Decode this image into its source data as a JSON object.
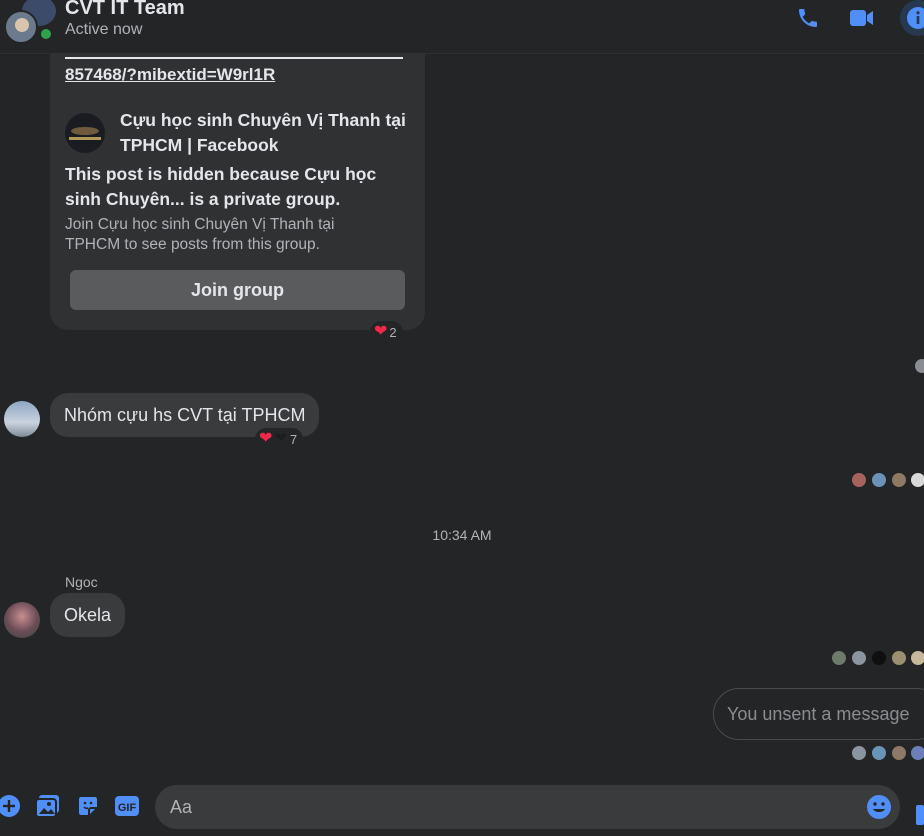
{
  "header": {
    "title": "CVT IT Team",
    "status": "Active now",
    "icons": [
      "phone-icon",
      "video-camera-icon",
      "info-icon"
    ]
  },
  "shared_post": {
    "link_text": "857468/?mibextid=W9rl1R",
    "group_name": "Cựu học sinh Chuyên Vị Thanh tại TPHCM | Facebook",
    "hidden_notice": "This post is hidden because Cựu học sinh Chuyên... is a private group.",
    "join_info": "Join Cựu học sinh Chuyên Vị Thanh tại TPHCM to see posts from this group.",
    "join_button": "Join group",
    "reaction_count": "2"
  },
  "messages": [
    {
      "text": "Nhóm cựu hs CVT tại TPHCM",
      "reaction_count": "7"
    },
    {
      "sender": "Ngoc",
      "text": "Okela"
    }
  ],
  "timestamp": "10:34 AM",
  "unsent_message": "You unsent a message",
  "composer": {
    "placeholder": "Aa",
    "icons": [
      "add-icon",
      "photo-icon",
      "sticker-icon",
      "gif-icon",
      "emoji-icon",
      "like-icon"
    ]
  },
  "colors": {
    "background": "#242526",
    "bubble": "#3a3b3c",
    "accent": "#4f8ff7",
    "online": "#31a24c",
    "heart": "#f02849"
  }
}
